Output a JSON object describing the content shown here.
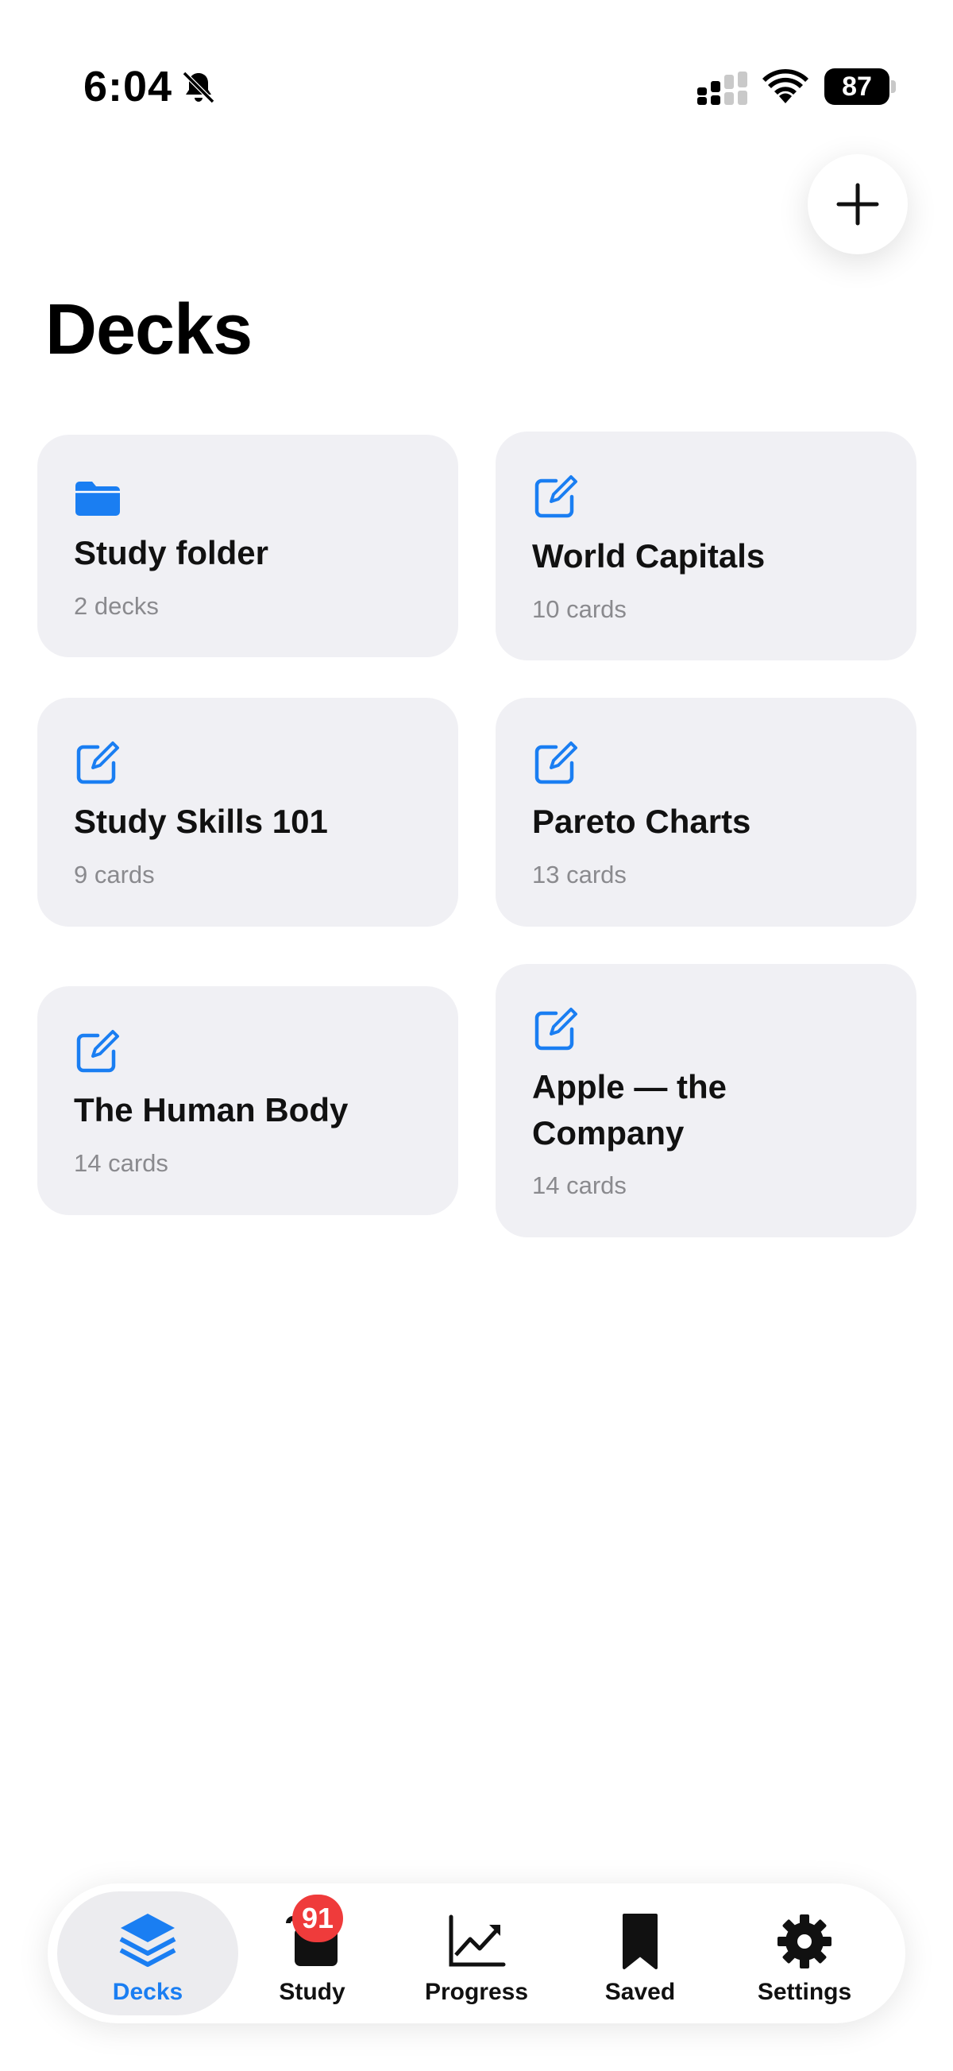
{
  "status_bar": {
    "time": "6:04",
    "battery": "87"
  },
  "header": {
    "title": "Decks"
  },
  "decks": [
    {
      "title": "Study folder",
      "subtitle": "2 decks",
      "icon": "folder-icon"
    },
    {
      "title": "World Capitals",
      "subtitle": "10 cards",
      "icon": "edit-icon"
    },
    {
      "title": "Study Skills 101",
      "subtitle": "9 cards",
      "icon": "edit-icon"
    },
    {
      "title": "Pareto Charts",
      "subtitle": "13 cards",
      "icon": "edit-icon"
    },
    {
      "title": "The Human Body",
      "subtitle": "14 cards",
      "icon": "edit-icon"
    },
    {
      "title": "Apple — the Company",
      "subtitle": "14 cards",
      "icon": "edit-icon"
    }
  ],
  "tabbar": {
    "tabs": [
      {
        "label": "Decks",
        "icon": "stack-icon",
        "active": true
      },
      {
        "label": "Study",
        "icon": "cards-icon"
      },
      {
        "label": "Progress",
        "icon": "chart-icon"
      },
      {
        "label": "Saved",
        "icon": "bookmark-icon"
      },
      {
        "label": "Settings",
        "icon": "gear-icon"
      }
    ],
    "study_badge": "91"
  },
  "colors": {
    "accent": "#1a7ef2",
    "card_bg": "#f0f0f4",
    "badge": "#ef3b3b",
    "subtitle": "#8a8a8e"
  }
}
